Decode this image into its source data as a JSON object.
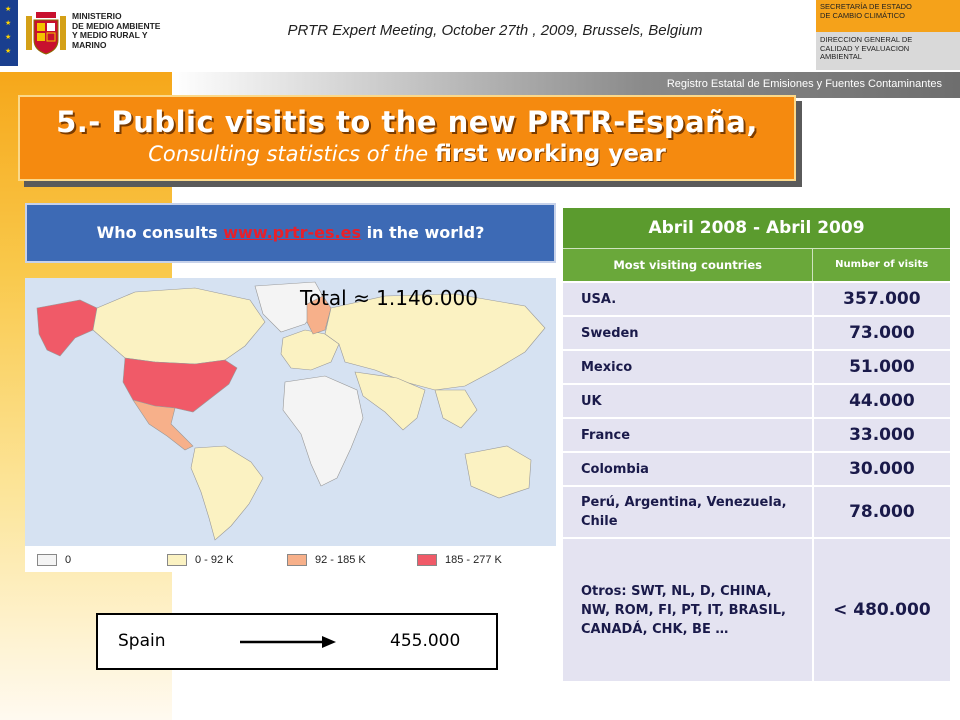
{
  "header": {
    "ministry_lines": [
      "MINISTERIO",
      "DE MEDIO AMBIENTE",
      "Y MEDIO RURAL Y MARINO"
    ],
    "conference": "PRTR Expert Meeting, October 27th , 2009, Brussels, Belgium",
    "secretaria": [
      "SECRETARÍA DE ESTADO",
      "DE CAMBIO CLIMÁTICO"
    ],
    "direccion": [
      "DIRECCION GENERAL DE",
      "CALIDAD Y EVALUACION",
      "AMBIENTAL"
    ],
    "registry": "Registro Estatal de Emisiones y Fuentes Contaminantes"
  },
  "title": {
    "main": "5.- Public visitis to the new PRTR-España,",
    "sub_regular": "Consulting statistics of the ",
    "sub_bold": "first working year"
  },
  "who": {
    "before": "Who consults ",
    "link": "www.prtr-es.es",
    "after": " in the world?"
  },
  "map": {
    "total": "Total  ≈ 1.146.000",
    "legend": [
      {
        "label": "0",
        "color": "#f4f4f4"
      },
      {
        "label": "0 - 92 K",
        "color": "#fbf2c2"
      },
      {
        "label": "92 - 185 K",
        "color": "#f7b08a"
      },
      {
        "label": "185 - 277 K",
        "color": "#f05a68"
      }
    ]
  },
  "spain": {
    "label": "Spain",
    "value": "455.000"
  },
  "table": {
    "period": "Abril 2008 - Abril 2009",
    "col1": "Most visiting countries",
    "col2": "Number of visits",
    "rows": [
      {
        "country": "USA.",
        "visits": "357.000"
      },
      {
        "country": "Sweden",
        "visits": "73.000"
      },
      {
        "country": "Mexico",
        "visits": "51.000"
      },
      {
        "country": "UK",
        "visits": "44.000"
      },
      {
        "country": "France",
        "visits": "33.000"
      },
      {
        "country": "Colombia",
        "visits": "30.000"
      },
      {
        "country": "Perú, Argentina, Venezuela, Chile",
        "visits": "78.000"
      },
      {
        "country": "Otros: SWT, NL, D, CHINA, NW, ROM, FI, PT, IT, BRASIL,  CANADÁ, CHK, BE …",
        "visits": "< 480.000"
      }
    ]
  },
  "colors": {
    "title_orange": "#f58a0f",
    "who_blue": "#3d6ab5",
    "table_green": "#5b9b2e",
    "row_lavender": "#e4e3f1",
    "link_red": "#e8202a"
  }
}
